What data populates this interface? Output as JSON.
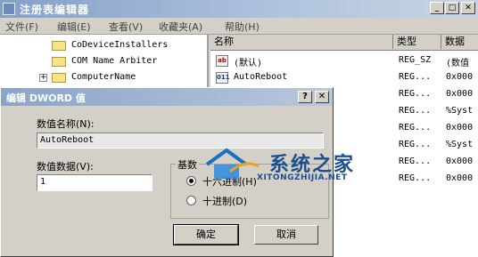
{
  "window": {
    "title": "注册表编辑器",
    "min": "_",
    "max": "□",
    "close": "✕"
  },
  "menu": [
    "文件(F)",
    "编辑(E)",
    "查看(V)",
    "收藏夹(A)",
    "帮助(H)"
  ],
  "tree": {
    "items": [
      {
        "label": "CoDeviceInstallers",
        "expander": ""
      },
      {
        "label": "COM Name Arbiter",
        "expander": ""
      },
      {
        "label": "ComputerName",
        "expander": "+"
      }
    ]
  },
  "list": {
    "headers": {
      "name": "名称",
      "type": "类型",
      "data": "数据"
    },
    "rows": [
      {
        "icon": "ab",
        "name": "(默认)",
        "type": "REG_SZ",
        "data": "(数值"
      },
      {
        "icon": "011",
        "name": "AutoReboot",
        "type": "REG...",
        "data": "0x000"
      },
      {
        "icon": "",
        "name": "",
        "type": "REG...",
        "data": "0x000"
      },
      {
        "icon": "",
        "name": "",
        "type": "REG...",
        "data": "%Syst"
      },
      {
        "icon": "",
        "name": "",
        "type": "REG...",
        "data": "0x000"
      },
      {
        "icon": "",
        "name": "",
        "type": "REG...",
        "data": "%Syst"
      },
      {
        "icon": "",
        "name": "",
        "type": "REG...",
        "data": "0x000"
      },
      {
        "icon": "",
        "name": "",
        "type": "REG...",
        "data": "0x000"
      }
    ]
  },
  "dialog": {
    "title": "编辑 DWORD 值",
    "help": "?",
    "close": "✕",
    "value_name_label": "数值名称(N):",
    "value_name": "AutoReboot",
    "value_data_label": "数值数据(V):",
    "value_data": "1",
    "base_label": "基数",
    "hex_label": "十六进制(H)",
    "dec_label": "十进制(D)",
    "base_selected": "hex",
    "ok": "确定",
    "cancel": "取消"
  },
  "watermark": {
    "name": "系统之家",
    "url": "XITONGZHIJIA.NET"
  }
}
